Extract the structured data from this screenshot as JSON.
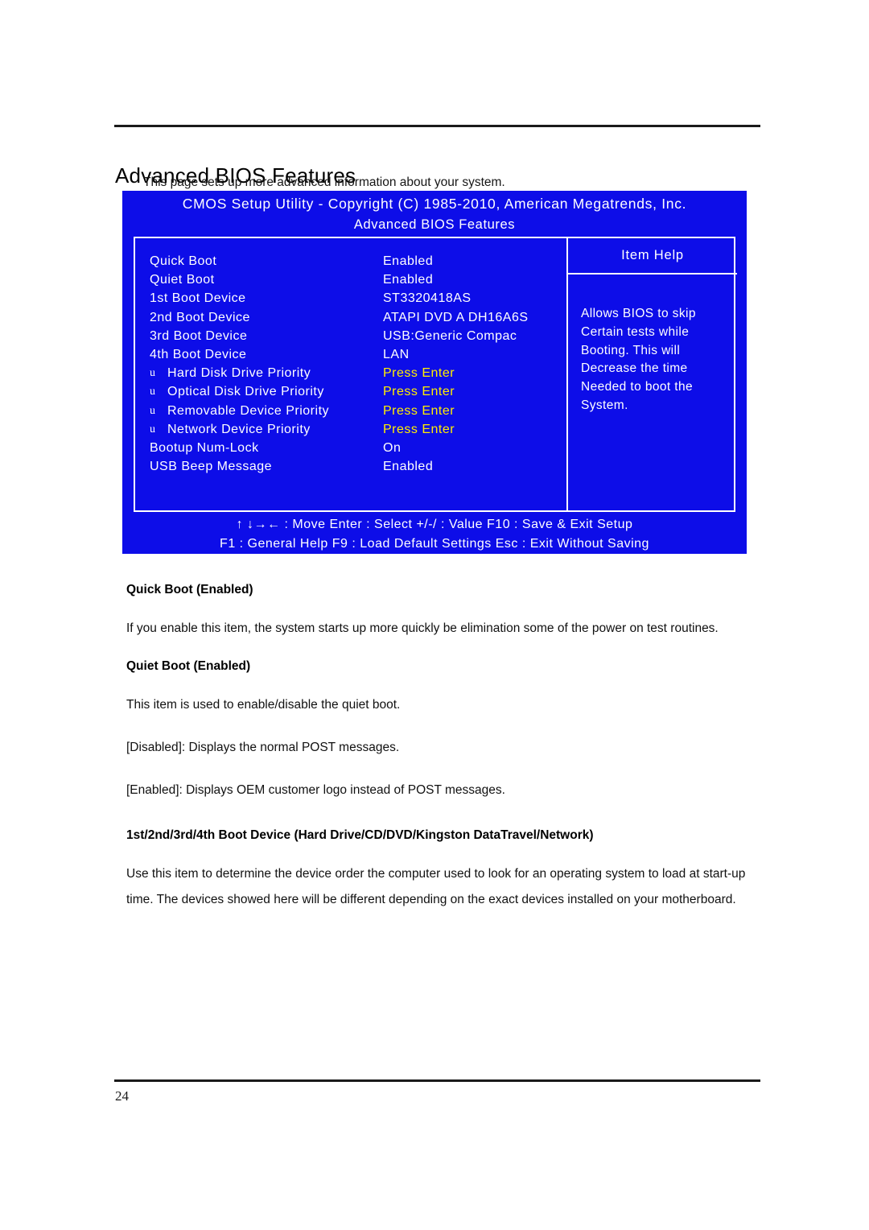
{
  "document": {
    "title": "Advanced BIOS Features",
    "subtitle": "This page sets up more advanced information about your system.",
    "page_number": "24"
  },
  "bios": {
    "header_line1": "CMOS Setup Utility - Copyright (C) 1985-2010, American Megatrends, Inc.",
    "header_line2": "Advanced BIOS Features",
    "settings": [
      {
        "bullet": "",
        "label": "Quick Boot",
        "value": "Enabled",
        "accent": false
      },
      {
        "bullet": "",
        "label": "Quiet Boot",
        "value": "Enabled",
        "accent": false
      },
      {
        "bullet": "",
        "label": "1st Boot Device",
        "value": "ST3320418AS",
        "accent": false
      },
      {
        "bullet": "",
        "label": "2nd Boot Device",
        "value": "ATAPI DVD A DH16A6S",
        "accent": false
      },
      {
        "bullet": "",
        "label": "3rd Boot Device",
        "value": "USB:Generic Compac",
        "accent": false
      },
      {
        "bullet": "",
        "label": "4th Boot Device",
        "value": "LAN",
        "accent": false
      },
      {
        "bullet": "u",
        "label": "Hard Disk Drive Priority",
        "value": "Press Enter",
        "accent": true
      },
      {
        "bullet": "u",
        "label": "Optical Disk Drive Priority",
        "value": "Press Enter",
        "accent": true
      },
      {
        "bullet": "u",
        "label": "Removable Device Priority",
        "value": "Press Enter",
        "accent": true
      },
      {
        "bullet": "u",
        "label": "Network Device Priority",
        "value": "Press Enter",
        "accent": true
      },
      {
        "bullet": "",
        "label": "Bootup Num-Lock",
        "value": "On",
        "accent": false
      },
      {
        "bullet": "",
        "label": "USB Beep Message",
        "value": "Enabled",
        "accent": false
      }
    ],
    "help": {
      "heading": "Item Help",
      "lines": [
        "Allows BIOS to skip",
        "Certain tests while",
        "Booting. This will",
        "Decrease the time",
        "Needed to boot the",
        "System."
      ]
    },
    "legend": {
      "line1": "↑ ↓→← : Move   Enter : Select   +/-/ : Value   F10 : Save & Exit Setup",
      "line2": "F1 : General Help      F9 : Load Default Settings   Esc :  Exit Without Saving"
    },
    "colors": {
      "background": "#0d0de8",
      "text": "#ffffff",
      "accent": "#ffee00"
    }
  },
  "body": {
    "sections": [
      {
        "heading": "Quick Boot (Enabled)",
        "paragraphs": [
          "If you enable this item, the system starts up more quickly be elimination some of the power on test routines."
        ]
      },
      {
        "heading": "Quiet Boot (Enabled)",
        "paragraphs": [
          "This item is used to enable/disable the quiet boot.",
          "[Disabled]: Displays the normal POST messages.",
          "[Enabled]: Displays OEM customer logo instead of POST messages."
        ]
      },
      {
        "heading": "1st/2nd/3rd/4th Boot Device (Hard Drive/CD/DVD/Kingston DataTravel/Network)",
        "paragraphs": [
          "Use this item to determine the device order the computer used to look for an operating system to load at start-up time. The devices showed here will be different depending on the exact devices installed on your motherboard."
        ]
      }
    ]
  }
}
